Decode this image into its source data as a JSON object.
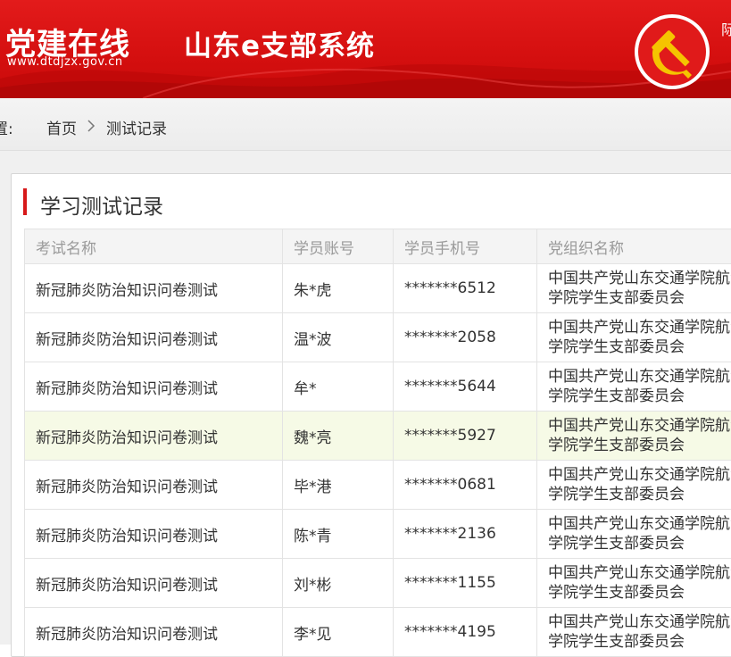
{
  "header": {
    "logo_text": "党建在线",
    "logo_url": "www.dtdjzx.gov.cn",
    "system_title": "山东e支部系统",
    "right_text": "际",
    "colors": {
      "banner": "#d40f0f",
      "emblem_gold": "#f5c400"
    }
  },
  "breadcrumb": {
    "label": "置:",
    "home": "首页",
    "separator_icon": "chevron-right-icon",
    "current": "测试记录"
  },
  "panel": {
    "title": "学习测试记录",
    "accent_color": "#d7191a"
  },
  "table": {
    "columns": [
      "考试名称",
      "学员账号",
      "学员手机号",
      "党组织名称"
    ],
    "rows": [
      {
        "exam": "新冠肺炎防治知识问卷测试",
        "account": "朱*虎",
        "phone": "*******6512",
        "org": "中国共产党山东交通学院航海学院学生支部委员会"
      },
      {
        "exam": "新冠肺炎防治知识问卷测试",
        "account": "温*波",
        "phone": "*******2058",
        "org": "中国共产党山东交通学院航海学院学生支部委员会"
      },
      {
        "exam": "新冠肺炎防治知识问卷测试",
        "account": "牟*",
        "phone": "*******5644",
        "org": "中国共产党山东交通学院航海学院学生支部委员会"
      },
      {
        "exam": "新冠肺炎防治知识问卷测试",
        "account": "魏*亮",
        "phone": "*******5927",
        "org": "中国共产党山东交通学院航海学院学生支部委员会",
        "highlighted": true
      },
      {
        "exam": "新冠肺炎防治知识问卷测试",
        "account": "毕*港",
        "phone": "*******0681",
        "org": "中国共产党山东交通学院航海学院学生支部委员会"
      },
      {
        "exam": "新冠肺炎防治知识问卷测试",
        "account": "陈*青",
        "phone": "*******2136",
        "org": "中国共产党山东交通学院航海学院学生支部委员会"
      },
      {
        "exam": "新冠肺炎防治知识问卷测试",
        "account": "刘*彬",
        "phone": "*******1155",
        "org": "中国共产党山东交通学院航海学院学生支部委员会"
      },
      {
        "exam": "新冠肺炎防治知识问卷测试",
        "account": "李*见",
        "phone": "*******4195",
        "org": "中国共产党山东交通学院航海学院学生支部委员会"
      }
    ]
  }
}
